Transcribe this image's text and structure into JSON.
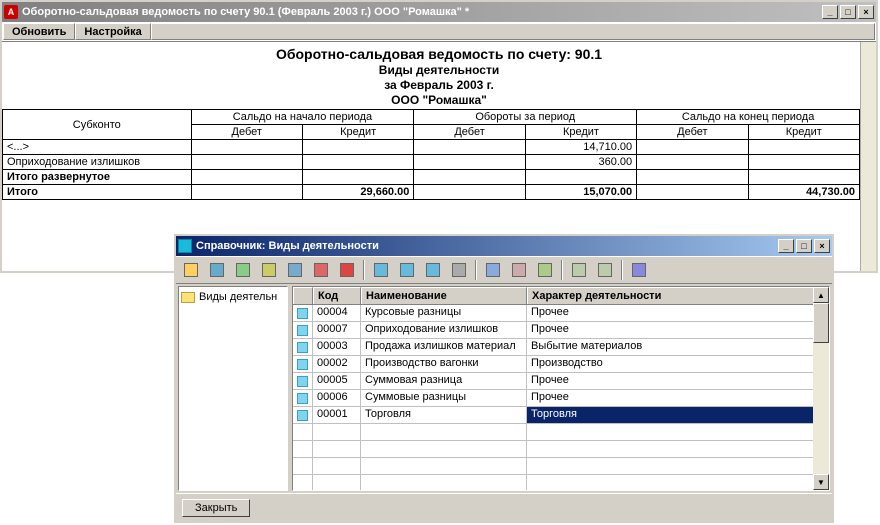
{
  "main_window": {
    "title": "Оборотно-сальдовая ведомость по счету 90.1 (Февраль 2003 г.) ООО \"Ромашка\" *",
    "menu": {
      "refresh": "Обновить",
      "settings": "Настройка"
    }
  },
  "report": {
    "title": "Оборотно-сальдовая ведомость по счету: 90.1",
    "subtitle1": "Виды деятельности",
    "subtitle2": "за Февраль 2003 г.",
    "subtitle3": "ООО \"Ромашка\"",
    "columns": {
      "subkonto": "Субконто",
      "start": "Сальдо на начало периода",
      "turnover": "Обороты за период",
      "end": "Сальдо на конец периода",
      "debit": "Дебет",
      "credit": "Кредит"
    },
    "rows": [
      {
        "label": "<...>",
        "sd": "",
        "sc": "",
        "td": "",
        "tc": "14,710.00",
        "ed": "",
        "ec": ""
      },
      {
        "label": "Оприходование излишков",
        "sd": "",
        "sc": "",
        "td": "",
        "tc": "360.00",
        "ed": "",
        "ec": ""
      }
    ],
    "totals": {
      "expanded_label": "Итого развернутое",
      "total_label": "Итого",
      "sd": "",
      "sc": "29,660.00",
      "td": "",
      "tc": "15,070.00",
      "ed": "",
      "ec": "44,730.00"
    }
  },
  "dict_window": {
    "title": "Справочник: Виды деятельности",
    "tree_root": "Виды деятельн",
    "columns": {
      "code": "Код",
      "name": "Наименование",
      "character": "Характер деятельности"
    },
    "rows": [
      {
        "code": "00004",
        "name": "Курсовые разницы",
        "character": "Прочее",
        "selected": false
      },
      {
        "code": "00007",
        "name": "Оприходование излишков",
        "character": "Прочее",
        "selected": false
      },
      {
        "code": "00003",
        "name": "Продажа излишков материал",
        "character": "Выбытие материалов",
        "selected": false
      },
      {
        "code": "00002",
        "name": "Производство вагонки",
        "character": "Производство",
        "selected": false
      },
      {
        "code": "00005",
        "name": "Суммовая разница",
        "character": "Прочее",
        "selected": false
      },
      {
        "code": "00006",
        "name": "Суммовые разницы",
        "character": "Прочее",
        "selected": false
      },
      {
        "code": "00001",
        "name": "Торговля",
        "character": "Торговля",
        "selected": true
      }
    ],
    "close_button": "Закрыть"
  },
  "toolbar_icons": [
    "new-folder-icon",
    "card-icon",
    "edit-icon",
    "copy-icon",
    "grid-icon",
    "grid-red-icon",
    "remove-icon",
    "sep",
    "tree-up-icon",
    "tree-down-icon",
    "tree-sel-icon",
    "history-icon",
    "sep",
    "find-icon",
    "cut-icon",
    "subentry-icon",
    "sep",
    "form-icon",
    "list-icon",
    "sep",
    "help-icon"
  ]
}
